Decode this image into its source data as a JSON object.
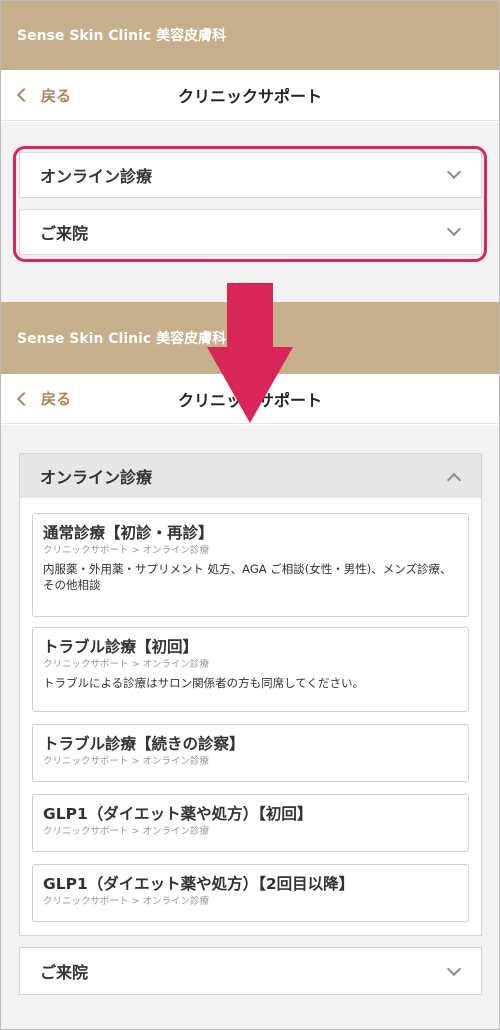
{
  "brand": {
    "name": "Sense Skin Clinic 美容皮膚科"
  },
  "nav": {
    "back_label": "戻る",
    "title": "クリニックサポート"
  },
  "accordion": {
    "online": "オンライン診療",
    "visit": "ご来院"
  },
  "cards": [
    {
      "title": "通常診療【初診・再診】",
      "crumb": "クリニックサポート > オンライン診療",
      "desc": "内服薬・外用薬・サプリメント 処方、AGA ご相談(女性・男性)、メンズ診療、その他相談"
    },
    {
      "title": "トラブル診療【初回】",
      "crumb": "クリニックサポート > オンライン診療",
      "desc": "トラブルによる診療はサロン関係者の方も同席してください。"
    },
    {
      "title": "トラブル診療【続きの診察】",
      "crumb": "クリニックサポート > オンライン診療",
      "desc": ""
    },
    {
      "title": "GLP1（ダイエット薬や処方）【初回】",
      "crumb": "クリニックサポート > オンライン診療",
      "desc": ""
    },
    {
      "title": "GLP1（ダイエット薬や処方）【2回目以降】",
      "crumb": "クリニックサポート > オンライン診療",
      "desc": ""
    }
  ],
  "colors": {
    "brand": "#c5b08b",
    "accent": "#a8875a",
    "highlight": "#d8255a"
  }
}
